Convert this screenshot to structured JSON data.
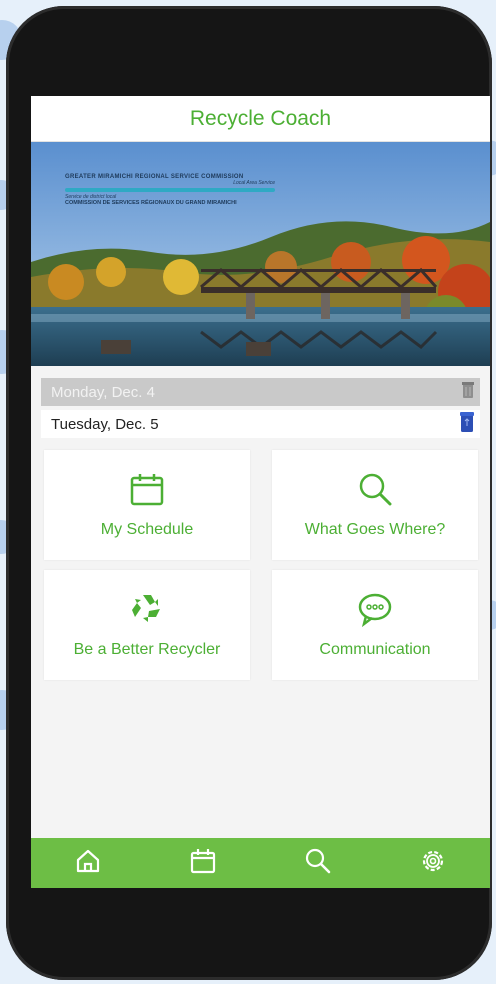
{
  "app": {
    "title": "Recycle Coach",
    "accent_color": "#4caf34",
    "nav_color": "#6dbe45"
  },
  "banner": {
    "org_name_en": "GREATER MIRAMICHI REGIONAL SERVICE COMMISSION",
    "org_tagline_en": "Local Area Service",
    "org_tagline_fr": "Service de district local",
    "org_name_fr": "COMMISSION DE SERVICES RÉGIONAUX DU GRAND MIRAMICHI",
    "scene": "autumn river with railway bridge"
  },
  "schedule": {
    "past_day": {
      "date": "Monday, Dec. 4",
      "icon": "garbage-can-icon"
    },
    "next_day": {
      "date": "Tuesday, Dec. 5",
      "icon": "recycling-bin-icon"
    }
  },
  "tiles": [
    {
      "label": "My Schedule",
      "icon": "calendar-icon"
    },
    {
      "label": "What Goes Where?",
      "icon": "search-icon"
    },
    {
      "label": "Be a Better Recycler",
      "icon": "recycle-icon"
    },
    {
      "label": "Communication",
      "icon": "chat-bubble-icon"
    }
  ],
  "bottom_nav": [
    {
      "name": "home",
      "icon": "home-icon"
    },
    {
      "name": "calendar",
      "icon": "calendar-icon"
    },
    {
      "name": "search",
      "icon": "search-icon"
    },
    {
      "name": "settings",
      "icon": "gear-icon"
    }
  ]
}
